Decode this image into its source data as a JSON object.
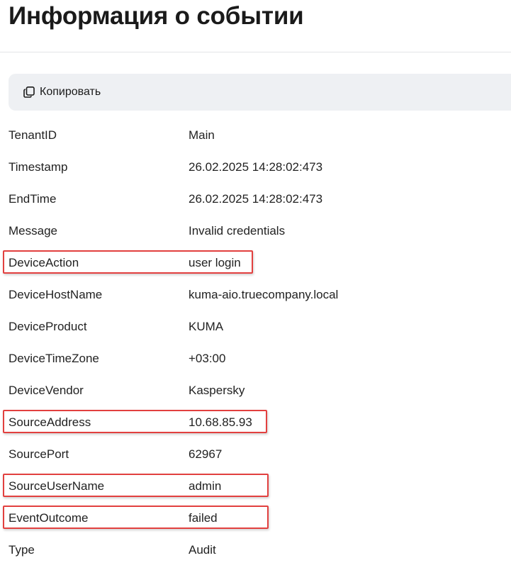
{
  "page": {
    "title": "Информация о событии"
  },
  "toolbar": {
    "copy_label": "Копировать",
    "copy_icon": "copy-icon"
  },
  "colors": {
    "highlight_border": "#e2403f",
    "toolbar_background": "#eef0f3"
  },
  "fields": [
    {
      "key": "TenantID",
      "value": "Main",
      "highlighted": false
    },
    {
      "key": "Timestamp",
      "value": "26.02.2025 14:28:02:473",
      "highlighted": false
    },
    {
      "key": "EndTime",
      "value": "26.02.2025 14:28:02:473",
      "highlighted": false
    },
    {
      "key": "Message",
      "value": "Invalid credentials",
      "highlighted": false
    },
    {
      "key": "DeviceAction",
      "value": "user login",
      "highlighted": true
    },
    {
      "key": "DeviceHostName",
      "value": "kuma-aio.truecompany.local",
      "highlighted": false
    },
    {
      "key": "DeviceProduct",
      "value": "KUMA",
      "highlighted": false
    },
    {
      "key": "DeviceTimeZone",
      "value": "+03:00",
      "highlighted": false
    },
    {
      "key": "DeviceVendor",
      "value": "Kaspersky",
      "highlighted": false
    },
    {
      "key": "SourceAddress",
      "value": "10.68.85.93",
      "highlighted": true
    },
    {
      "key": "SourcePort",
      "value": "62967",
      "highlighted": false
    },
    {
      "key": "SourceUserName",
      "value": "admin",
      "highlighted": true
    },
    {
      "key": "EventOutcome",
      "value": "failed",
      "highlighted": true
    },
    {
      "key": "Type",
      "value": "Audit",
      "highlighted": false
    }
  ]
}
